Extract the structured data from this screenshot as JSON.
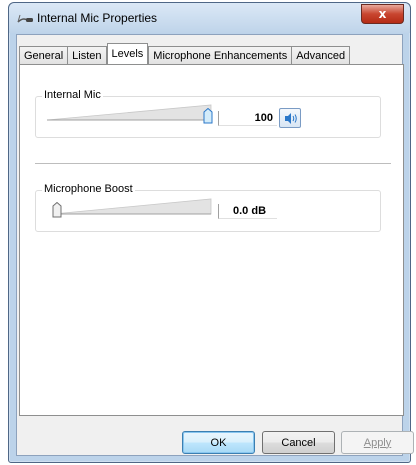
{
  "window": {
    "title": "Internal Mic Properties",
    "close_glyph": "x"
  },
  "tabs": [
    {
      "label": "General"
    },
    {
      "label": "Listen"
    },
    {
      "label": "Levels",
      "active": true
    },
    {
      "label": "Microphone Enhancements"
    },
    {
      "label": "Advanced"
    }
  ],
  "levels": {
    "internal_mic": {
      "label": "Internal Mic",
      "value": "100",
      "level_fraction": 1.0,
      "muted": false
    },
    "microphone_boost": {
      "label": "Microphone Boost",
      "value": "0.0 dB",
      "level_fraction": 0.0
    }
  },
  "buttons": {
    "ok": "OK",
    "cancel": "Cancel",
    "apply": "Apply"
  },
  "icons": {
    "window": "microphone-icon",
    "mute_toggle": "speaker-icon",
    "close": "close-icon"
  },
  "colors": {
    "accent_blue": "#2a77c9",
    "close_red": "#c8452f"
  }
}
